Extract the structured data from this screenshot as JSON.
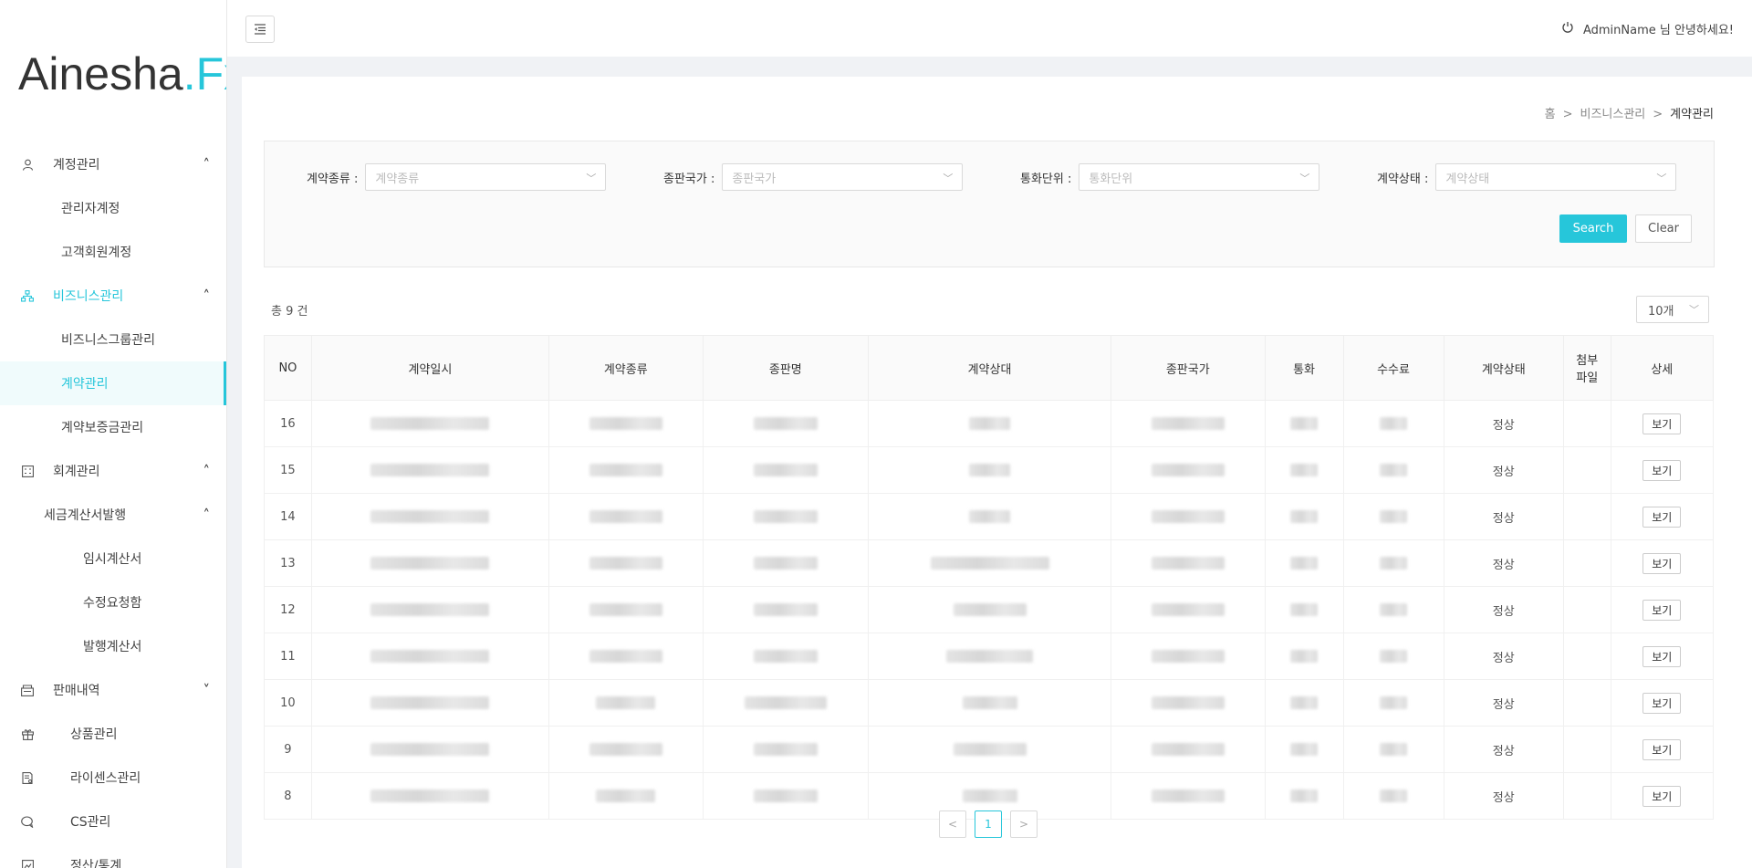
{
  "logo": {
    "main": "Ainesha",
    "dot": ".",
    "fx": "Fx"
  },
  "sidebar": {
    "items": [
      {
        "label": "계정관리",
        "icon": "user-icon",
        "chevron": "˄",
        "level": 0
      },
      {
        "label": "관리자계정",
        "level": 1
      },
      {
        "label": "고객회원계정",
        "level": 1
      },
      {
        "label": "비즈니스관리",
        "icon": "org-chart-icon",
        "chevron": "˄",
        "level": 0,
        "state": "active-parent"
      },
      {
        "label": "비즈니스그룹관리",
        "level": 1
      },
      {
        "label": "계약관리",
        "level": 1,
        "state": "active"
      },
      {
        "label": "계약보증금관리",
        "level": 1
      },
      {
        "label": "회계관리",
        "icon": "calculator-icon",
        "chevron": "˄",
        "level": 0
      },
      {
        "label": "세금계산서발행",
        "chevron": "˄",
        "level": 2
      },
      {
        "label": "임시계산서",
        "level": 3
      },
      {
        "label": "수정요청함",
        "level": 3
      },
      {
        "label": "발행계산서",
        "level": 3
      },
      {
        "label": "판매내역",
        "icon": "register-icon",
        "chevron": "˅",
        "level": 0
      },
      {
        "label": "상품관리",
        "icon": "gift-icon",
        "level": 4
      },
      {
        "label": "라이센스관리",
        "icon": "license-icon",
        "level": 4
      },
      {
        "label": "CS관리",
        "icon": "chat-icon",
        "level": 4
      },
      {
        "label": "정산/통계",
        "icon": "chart-icon",
        "level": 4
      }
    ]
  },
  "header": {
    "toggle_icon": "menu-fold-icon",
    "user_text": "AdminName 님 안녕하세요!"
  },
  "breadcrumb": {
    "home": "홈",
    "sep": ">",
    "parent": "비즈니스관리",
    "current": "계약관리"
  },
  "filters": [
    {
      "label": "계약종류 :",
      "placeholder": "계약종류"
    },
    {
      "label": "종판국가 :",
      "placeholder": "종판국가"
    },
    {
      "label": "통화단위 :",
      "placeholder": "통화단위"
    },
    {
      "label": "계약상태 :",
      "placeholder": "계약상태"
    }
  ],
  "buttons": {
    "search": "Search",
    "clear": "Clear"
  },
  "total_text": "총 9 건",
  "page_size": "10개",
  "table": {
    "columns": [
      "NO",
      "계약일시",
      "계약종류",
      "종판명",
      "계약상대",
      "종판국가",
      "통화",
      "수수료",
      "계약상태",
      "첨부\n파일",
      "상세"
    ],
    "rows": [
      {
        "no": "16",
        "status": "정상",
        "detail": "보기"
      },
      {
        "no": "15",
        "status": "정상",
        "detail": "보기"
      },
      {
        "no": "14",
        "status": "정상",
        "detail": "보기"
      },
      {
        "no": "13",
        "status": "정상",
        "detail": "보기"
      },
      {
        "no": "12",
        "status": "정상",
        "detail": "보기"
      },
      {
        "no": "11",
        "status": "정상",
        "detail": "보기"
      },
      {
        "no": "10",
        "status": "정상",
        "detail": "보기"
      },
      {
        "no": "9",
        "status": "정상",
        "detail": "보기"
      },
      {
        "no": "8",
        "status": "정상",
        "detail": "보기"
      }
    ]
  },
  "pagination": {
    "prev": "<",
    "current": "1",
    "next": ">"
  },
  "colors": {
    "accent": "#26c6da"
  }
}
